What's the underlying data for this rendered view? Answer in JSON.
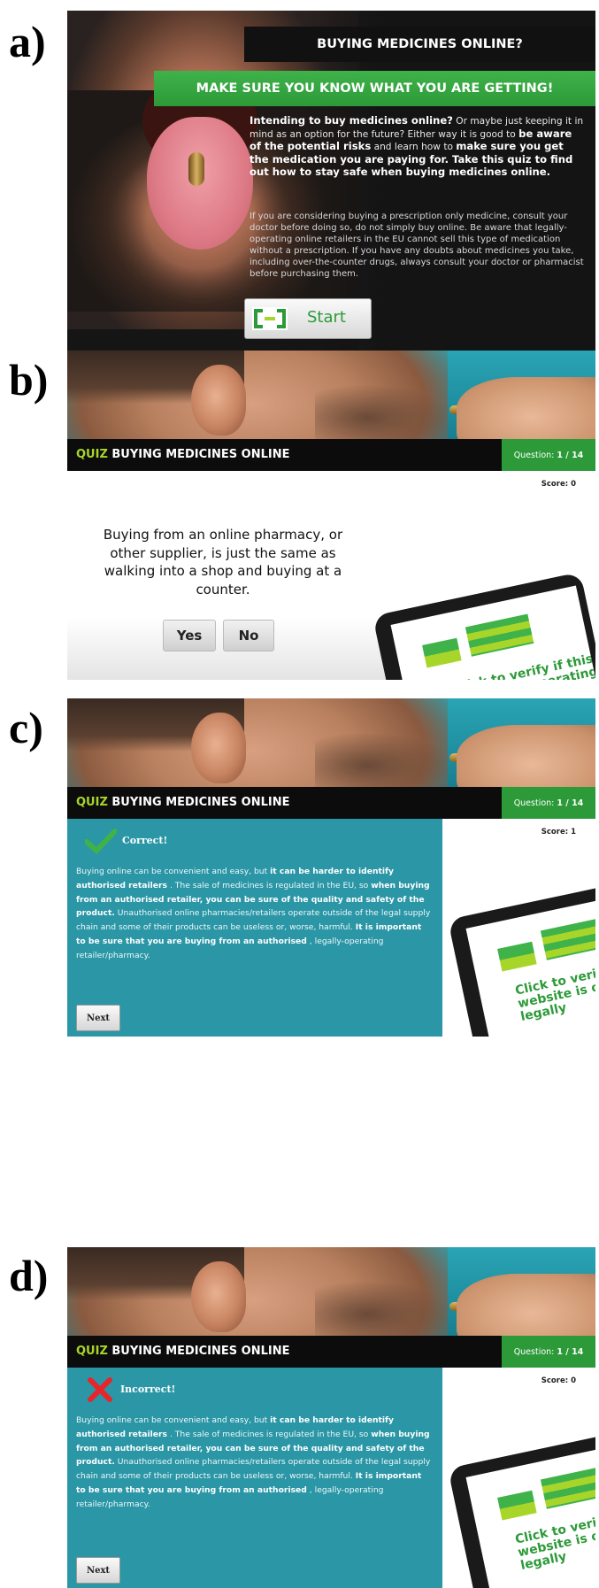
{
  "labels": {
    "a": "a)",
    "b": "b)",
    "c": "c)",
    "d": "d)"
  },
  "intro": {
    "title": "BUYING MEDICINES ONLINE?",
    "subtitle": "MAKE SURE YOU KNOW WHAT YOU ARE GETTING!",
    "p1_a": "Intending to buy medicines online?",
    "p1_b": " Or maybe just keeping it in mind as an option for the future? Either way it is good to ",
    "p1_c": "be aware of the potential risks",
    "p1_d": " and learn how to ",
    "p1_e": "make sure you get the medication you are paying for. Take this quiz to find out how to stay safe when buying medicines online.",
    "p2": "If you are considering buying a prescription only medicine, consult your doctor before doing so, do not simply buy online. Be aware that legally-operating online retailers in the EU cannot sell this type of medication without a prescription. If you have any doubts about medicines you take, including over-the-counter drugs, always consult your doctor or pharmacist before purchasing them.",
    "start_label": "Start"
  },
  "quiz": {
    "quiz_word": "QUIZ",
    "title": " BUYING MEDICINES ONLINE",
    "question_label": "Question:",
    "question_num": "1 / 14",
    "score_label": "Score:",
    "score_b": "0",
    "score_c": "1",
    "score_d": "0",
    "question_text": "Buying from an online pharmacy, or other supplier, is just the same as walking into a shop and buying at a counter.",
    "yes_label": "Yes",
    "no_label": "No",
    "verify_text": "Click to verify if this website is operating legally",
    "correct_label": "Correct!",
    "incorrect_label": "Incorrect!",
    "next_label": "Next",
    "fb_1": "Buying online can be convenient and easy, but ",
    "fb_2": "it can be harder to identify authorised retailers",
    "fb_3": " . The sale of medicines is regulated in the EU, so ",
    "fb_4": "when buying from an authorised retailer, you can be sure of the quality and safety of the product.",
    "fb_5": " Unauthorised online pharmacies/retailers operate outside of the legal supply chain and some of their products can be useless or, worse, harmful. ",
    "fb_6": "It is important to be sure that you are buying from an authorised",
    "fb_7": " , legally-operating retailer/pharmacy."
  },
  "colors": {
    "green": "#2c9a38",
    "lime": "#a8d52a",
    "teal": "#2a96a6",
    "bar": "#0c0c0c"
  }
}
